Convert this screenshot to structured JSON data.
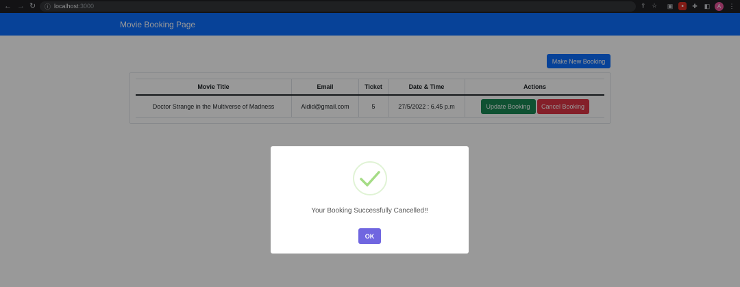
{
  "browser": {
    "url_host": "localhost",
    "url_port": ":3000",
    "avatar_letter": "A"
  },
  "navbar": {
    "brand": "Movie Booking Page"
  },
  "toolbar": {
    "new_booking_label": "Make New Booking"
  },
  "table": {
    "headers": [
      "Movie Title",
      "Email",
      "Ticket",
      "Date & Time",
      "Actions"
    ],
    "rows": [
      {
        "movie_title": "Doctor Strange in the Multiverse of Madness",
        "email": "Aidid@gmail.com",
        "ticket": "5",
        "date_time": "27/5/2022 : 6.45 p.m",
        "update_label": "Update Booking",
        "cancel_label": "Cancel Booking"
      }
    ]
  },
  "dialog": {
    "message": "Your Booking Successfully Cancelled!!",
    "ok_label": "OK",
    "icon": "success-check-icon"
  },
  "colors": {
    "navbar": "#0d6efd",
    "update_button": "#198754",
    "cancel_button": "#dc3545",
    "ok_button": "#7066e0",
    "success_check": "#a5dc86"
  }
}
